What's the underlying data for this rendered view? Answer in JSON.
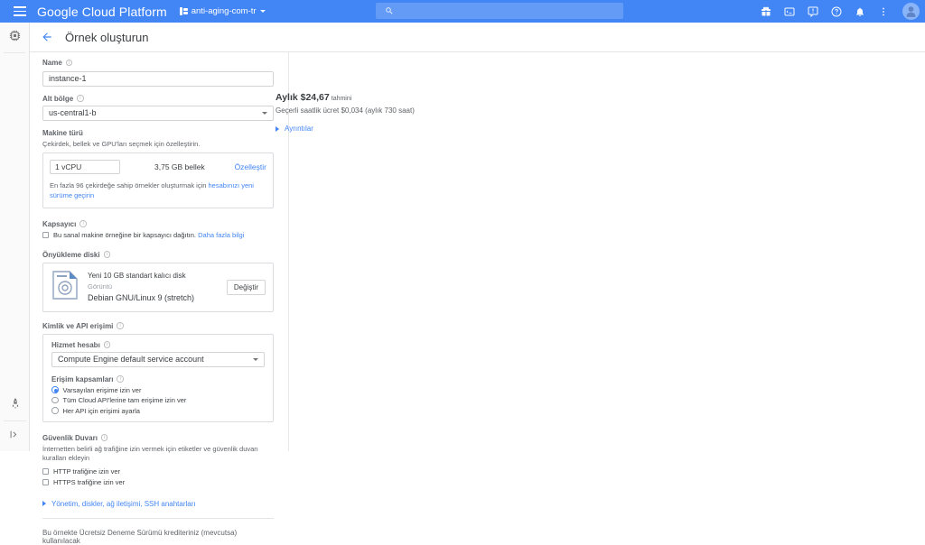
{
  "header": {
    "menu_icon": "hamburger-menu-icon",
    "brand": "Google Cloud Platform",
    "project": "anti-aging-com-tr",
    "search_placeholder": "",
    "search_value": "",
    "icons": [
      "gift-icon",
      "terminal-icon",
      "feedback-icon",
      "help-icon",
      "notifications-icon",
      "more-vert-icon"
    ],
    "accent": "#4285f4"
  },
  "rail": {
    "top_icon": "cpu-chip-icon",
    "marketplace_icon": "marketplace-icon",
    "expand_icon": "expand-panel-icon"
  },
  "page": {
    "back_icon": "back-arrow-icon",
    "title": "Örnek oluşturun"
  },
  "form": {
    "name": {
      "label": "Name",
      "value": "instance-1"
    },
    "zone": {
      "label": "Alt bölge",
      "value": "us-central1-b"
    },
    "machine_type": {
      "label": "Makine türü",
      "description": "Çekirdek, bellek ve GPU'ları seçmek için özelleştirin.",
      "cpu": "1 vCPU",
      "memory": "3,75 GB bellek",
      "customize_link": "Özelleştir",
      "note_pre": "En fazla 96 çekirdeğe sahip örnekler oluşturmak için ",
      "note_link": "hesabınızı yeni sürüme geçirin"
    },
    "container": {
      "label": "Kapsayıcı",
      "checkbox_label": "Bu sanal makine örneğine bir kapsayıcı dağıtın.",
      "more_link": "Daha fazla bilgi",
      "checked": false
    },
    "boot_disk": {
      "label": "Önyükleme diski",
      "icon": "disk-image-icon",
      "line1": "Yeni 10 GB standart kalıcı disk",
      "line2": "Görüntü",
      "line3": "Debian GNU/Linux 9 (stretch)",
      "change_button": "Değiştir"
    },
    "identity": {
      "label": "Kimlik ve API erişimi",
      "service_account_label": "Hizmet hesabı",
      "service_account_value": "Compute Engine default service account",
      "scopes_label": "Erişim kapsamları",
      "scopes": [
        {
          "label": "Varsayılan erişime izin ver",
          "selected": true
        },
        {
          "label": "Tüm Cloud API'lerine tam erişime izin ver",
          "selected": false
        },
        {
          "label": "Her API için erişimi ayarla",
          "selected": false
        }
      ]
    },
    "firewall": {
      "label": "Güvenlik Duvarı",
      "description": "İnternetten belirli ağ trafiğine izin vermek için etiketler ve güvenlik duvarı kuralları ekleyin",
      "options": [
        {
          "label": "HTTP trafiğine izin ver",
          "checked": false
        },
        {
          "label": "HTTPS trafiğine izin ver",
          "checked": false
        }
      ]
    },
    "advanced_link": "Yönetim, diskler, ağ iletişimi, SSH anahtarları",
    "footnote": "Bu örnekte Ücretsiz Deneme Sürümü krediteriniz (mevcutsa) kullanılacak"
  },
  "pricing": {
    "monthly": "Aylık $24,67",
    "estimate_suffix": "tahmini",
    "hourly": "Geçerli saatlik ücret $0,034 (aylık 730 saat)",
    "details_link": "Ayrıntılar"
  }
}
